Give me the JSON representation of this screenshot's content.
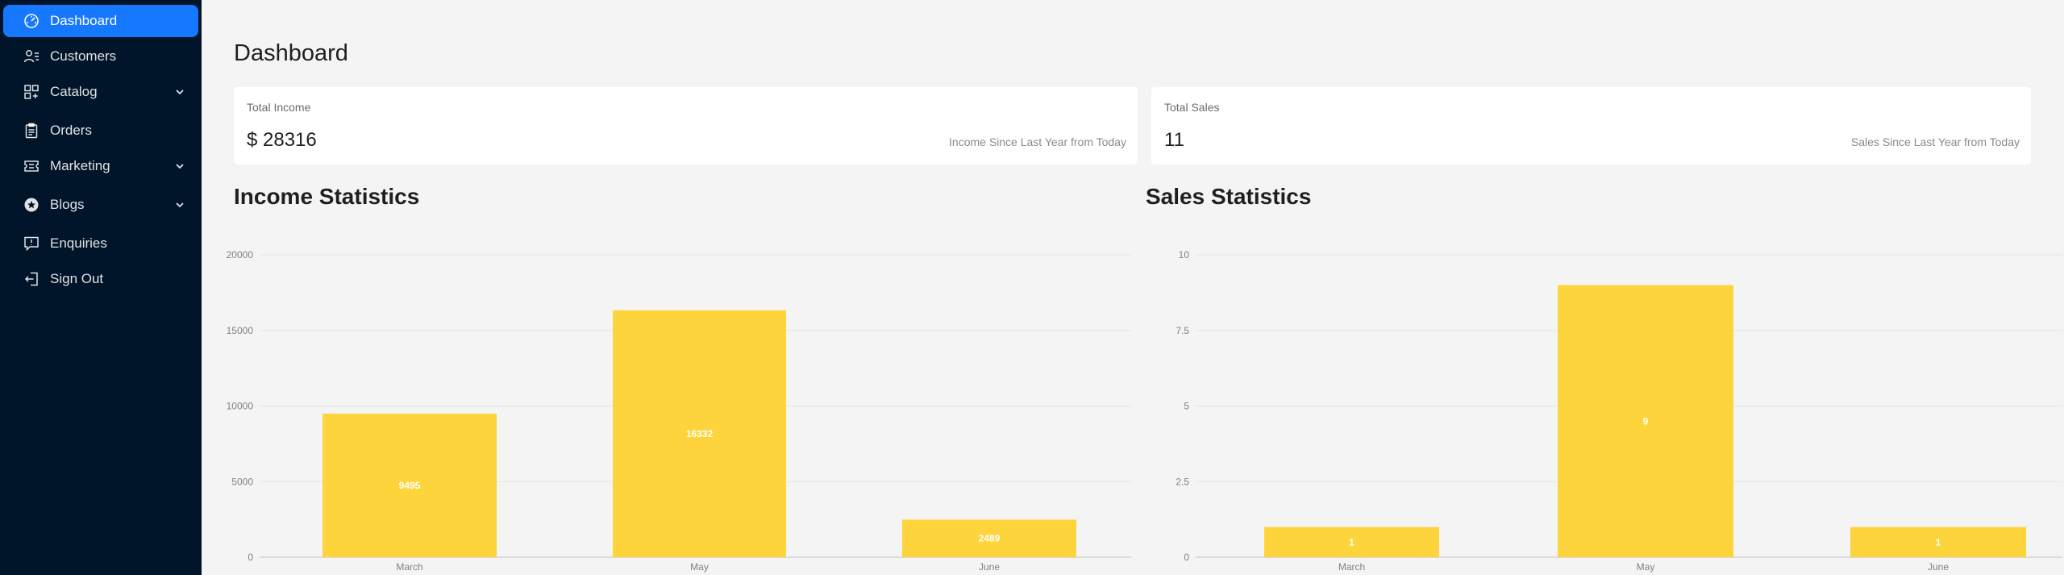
{
  "sidebar": {
    "items": [
      {
        "label": "Dashboard",
        "icon": "dashboard-icon",
        "active": true,
        "has_submenu": false
      },
      {
        "label": "Customers",
        "icon": "user-icon",
        "active": false,
        "has_submenu": false
      },
      {
        "label": "Catalog",
        "icon": "catalog-icon",
        "active": false,
        "has_submenu": true
      },
      {
        "label": "Orders",
        "icon": "clipboard-icon",
        "active": false,
        "has_submenu": false
      },
      {
        "label": "Marketing",
        "icon": "ticket-icon",
        "active": false,
        "has_submenu": true
      },
      {
        "label": "Blogs",
        "icon": "star-badge-icon",
        "active": false,
        "has_submenu": true
      },
      {
        "label": "Enquiries",
        "icon": "message-icon",
        "active": false,
        "has_submenu": false
      },
      {
        "label": "Sign Out",
        "icon": "logout-icon",
        "active": false,
        "has_submenu": false
      }
    ]
  },
  "main": {
    "title": "Dashboard",
    "cards": [
      {
        "label": "Total Income",
        "value": "$ 28316",
        "subtitle": "Income Since Last Year from Today"
      },
      {
        "label": "Total Sales",
        "value": "11",
        "subtitle": "Sales Since Last Year from Today"
      }
    ],
    "income_title": "Income Statistics",
    "sales_title": "Sales Statistics"
  },
  "colors": {
    "sidebar_bg": "#001529",
    "active_item": "#1677ff",
    "bar": "#fdd43c"
  },
  "chart_data": [
    {
      "type": "bar",
      "title": "Income Statistics",
      "categories": [
        "March",
        "May",
        "June"
      ],
      "values": [
        9495,
        16332,
        2489
      ],
      "data_labels": [
        "9495",
        "16332",
        "2489"
      ],
      "ylim": [
        0,
        20000
      ],
      "yticks": [
        "0",
        "5000",
        "10000",
        "15000",
        "20000"
      ],
      "grid": true
    },
    {
      "type": "bar",
      "title": "Sales Statistics",
      "categories": [
        "March",
        "May",
        "June"
      ],
      "values": [
        1,
        9,
        1
      ],
      "data_labels": [
        "1",
        "9",
        "1"
      ],
      "ylim": [
        0,
        10
      ],
      "yticks": [
        "0",
        "2.5",
        "5",
        "7.5",
        "10"
      ],
      "grid": true
    }
  ]
}
